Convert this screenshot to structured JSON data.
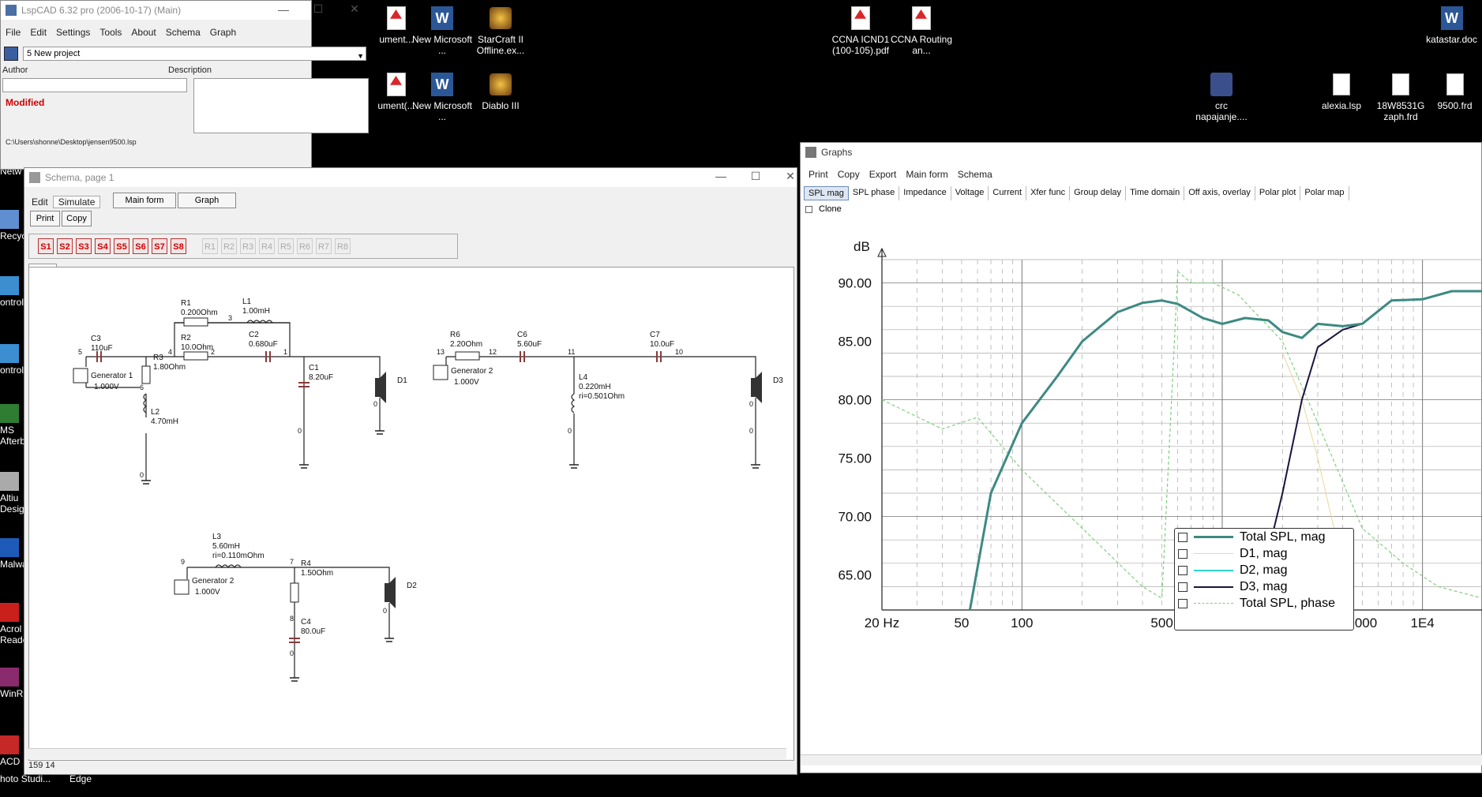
{
  "desktop": {
    "top_icons": [
      {
        "label": "ument...",
        "type": "pdf"
      },
      {
        "label": "New Microsoft ...",
        "type": "word"
      },
      {
        "label": "StarCraft II Offline.ex...",
        "type": "game"
      },
      {
        "label": "CCNA ICND1 (100-105).pdf",
        "type": "pdf"
      },
      {
        "label": "CCNA Routing an...",
        "type": "pdf"
      },
      {
        "label": "katastar.doc",
        "type": "word"
      }
    ],
    "second_icons": [
      {
        "label": "ument(...",
        "type": "pdf"
      },
      {
        "label": "New Microsoft ...",
        "type": "word"
      },
      {
        "label": "Diablo III",
        "type": "game"
      },
      {
        "label": "crc napajanje....",
        "type": "app"
      },
      {
        "label": "alexia.lsp",
        "type": "file"
      },
      {
        "label": "18W8531G zaph.frd",
        "type": "file"
      },
      {
        "label": "9500.frd",
        "type": "file"
      }
    ],
    "side_labels": [
      "Netw",
      "Recycl",
      "ontrol",
      "ontrol",
      "MS Afterbu",
      "Altiu Desig",
      "Malwar",
      "Acrol Reade",
      "WinR",
      "ACD",
      "hoto Studi..."
    ],
    "taskbar_label": "Edge"
  },
  "lspcad": {
    "title": "LspCAD 6.32 pro (2006-10-17) (Main)",
    "menu": [
      "File",
      "Edit",
      "Settings",
      "Tools",
      "About",
      "Schema",
      "Graph"
    ],
    "project": "5 New project",
    "author_label": "Author",
    "description_label": "Description",
    "status": "Modified",
    "path": "C:\\Users\\shonne\\Desktop\\jensen9500.lsp"
  },
  "schema": {
    "title": "Schema, page 1",
    "menu": [
      "Edit",
      "Simulate"
    ],
    "main_form": "Main form",
    "graph": "Graph",
    "print": "Print",
    "copy": "Copy",
    "s_buttons": [
      "S1",
      "S2",
      "S3",
      "S4",
      "S5",
      "S6",
      "S7",
      "S8"
    ],
    "r_buttons": [
      "R1",
      "R2",
      "R3",
      "R4",
      "R5",
      "R6",
      "R7",
      "R8"
    ],
    "page_select": "1",
    "status": "159  14",
    "components": {
      "r1": "R1",
      "r1v": "0.200Ohm",
      "l1": "L1",
      "l1v": "1.00mH",
      "r2": "R2",
      "r2v": "10.0Ohm",
      "c2": "C2",
      "c2v": "0.680uF",
      "c3": "C3",
      "c3v": "110uF",
      "r3": "R3",
      "r3v": "1.80Ohm",
      "c1": "C1",
      "c1v": "8.20uF",
      "gen1": "Generator 1",
      "gen1v": "1.000V",
      "l2": "L2",
      "l2v": "4.70mH",
      "d1": "D1",
      "r6": "R6",
      "r6v": "2.20Ohm",
      "c6": "C6",
      "c6v": "5.60uF",
      "c7": "C7",
      "c7v": "10.0uF",
      "gen2": "Generator 2",
      "gen2v": "1.000V",
      "l4": "L4",
      "l4v": "0.220mH",
      "l4r": "ri=0.501Ohm",
      "d3": "D3",
      "l3": "L3",
      "l3v": "5.60mH",
      "l3r": "ri=0.110mOhm",
      "r4": "R4",
      "r4v": "1.50Ohm",
      "gen3": "Generator 2",
      "gen3v": "1.000V",
      "c4": "C4",
      "c4v": "80.0uF",
      "d2": "D2",
      "nodes": [
        "5",
        "4",
        "3",
        "2",
        "1",
        "6",
        "0",
        "0",
        "0",
        "13",
        "12",
        "11",
        "10",
        "0",
        "0",
        "0",
        "9",
        "7",
        "8",
        "0",
        "0"
      ]
    }
  },
  "graphs": {
    "title": "Graphs",
    "menu": [
      "Print",
      "Copy",
      "Export",
      "Main form",
      "Schema"
    ],
    "tabs": [
      "SPL mag",
      "SPL phase",
      "Impedance",
      "Voltage",
      "Current",
      "Xfer func",
      "Group delay",
      "Time domain",
      "Off axis, overlay",
      "Polar plot",
      "Polar map"
    ],
    "clone_label": "Clone",
    "colors": {
      "total": "#3d8a82",
      "d1": "#e6d89a",
      "d2": "#2ed4d0",
      "d3": "#1a1440",
      "phase": "#7fcf7f"
    },
    "chart_data": {
      "type": "line",
      "ylabel": "dB",
      "yticks": [
        "90.00",
        "85.00",
        "80.00",
        "75.00",
        "70.00",
        "65.00"
      ],
      "xticks": [
        "20 Hz",
        "50",
        "100",
        "500",
        "1000",
        "5000",
        "1E4"
      ],
      "ylim": [
        62,
        92
      ],
      "xlim": [
        20,
        20000
      ],
      "x_scale": "log",
      "grid": true,
      "legend_placement": "bottom-center",
      "series": [
        {
          "name": "Total SPL, mag",
          "x": [
            55,
            70,
            100,
            150,
            200,
            300,
            400,
            500,
            600,
            800,
            1000,
            1300,
            1700,
            2000,
            2500,
            3000,
            4000,
            5000,
            7000,
            10000,
            14000,
            20000
          ],
          "y": [
            62,
            72,
            78,
            82,
            85,
            87.5,
            88.3,
            88.5,
            88.2,
            87,
            86.5,
            87,
            86.8,
            85.8,
            85.3,
            86.5,
            86.3,
            86.5,
            88.5,
            88.6,
            89.3,
            89.3
          ]
        },
        {
          "name": "D1, mag",
          "x": [
            2000,
            2500,
            3000,
            3500,
            4000,
            4500
          ],
          "y": [
            84,
            80,
            75,
            70,
            66,
            62
          ]
        },
        {
          "name": "D2, mag",
          "x": [],
          "y": []
        },
        {
          "name": "D3, mag",
          "x": [
            1400,
            1700,
            2000,
            2500,
            3000,
            4000,
            5000,
            7000,
            10000,
            14000,
            20000
          ],
          "y": [
            62,
            67,
            72,
            80,
            84.5,
            86,
            86.5,
            88.5,
            88.6,
            89.3,
            89.3
          ]
        },
        {
          "name": "Total SPL, phase",
          "x": [
            20,
            40,
            60,
            100,
            200,
            400,
            500,
            600,
            700,
            900,
            1200,
            2000,
            3000,
            5000,
            8000,
            12000,
            20000
          ],
          "y": [
            80,
            77.5,
            78.5,
            74,
            69,
            64,
            63,
            91,
            90,
            90,
            89,
            85,
            78,
            69,
            66,
            64,
            63
          ]
        }
      ]
    }
  }
}
